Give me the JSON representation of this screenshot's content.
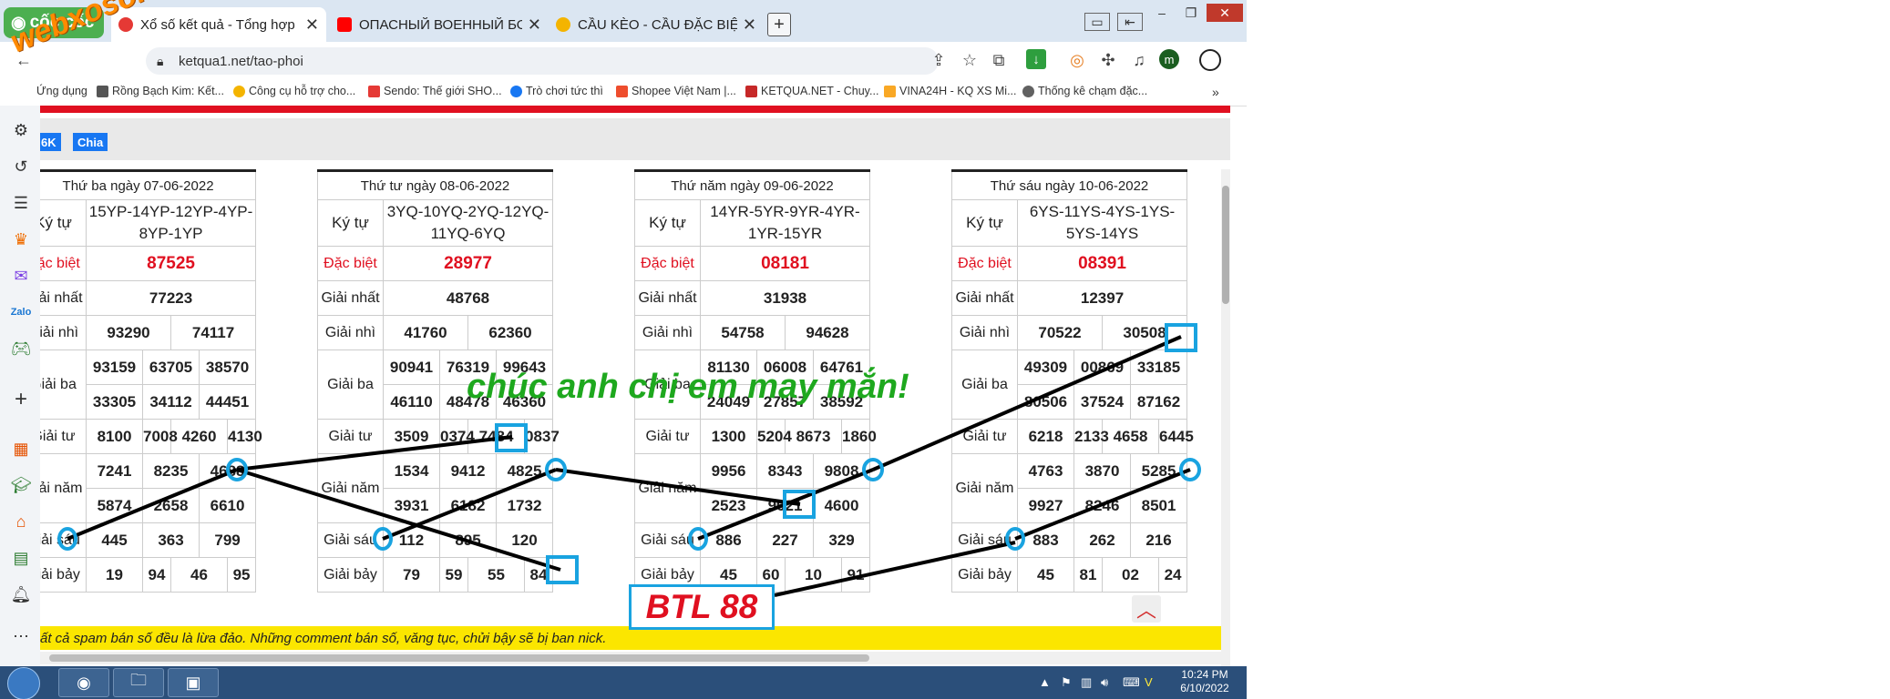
{
  "browser": {
    "brand": "cốc cốc",
    "tabs": [
      {
        "title": "Xổ số kết quả - Tổng hợp",
        "active": true,
        "fav_color": "#e53935"
      },
      {
        "title": "ОПАСНЫЙ ВОЕННЫЙ БОЕВ",
        "active": false,
        "fav_color": "#ff0000"
      },
      {
        "title": "CẦU KÈO - CẦU ĐẶC BIỆT NG",
        "active": false,
        "fav_color": "#f4b400"
      }
    ],
    "url": "ketqua1.net/tao-phoi",
    "profile_initial": "m"
  },
  "bookmarks": [
    {
      "label": "Ứng dụng",
      "color": "#4285f4"
    },
    {
      "label": "Rồng Bạch Kim: Kết...",
      "color": "#555555"
    },
    {
      "label": "Công cụ hỗ trợ cho...",
      "color": "#f4b400"
    },
    {
      "label": "Sendo: Thế giới SHO...",
      "color": "#e53935"
    },
    {
      "label": "Trò chơi tức thì",
      "color": "#1877f2"
    },
    {
      "label": "Shopee Việt Nam |...",
      "color": "#ee4d2d"
    },
    {
      "label": "KETQUA.NET - Chuy...",
      "color": "#c62828"
    },
    {
      "label": "VINA24H - KQ XS Mi...",
      "color": "#f9a825"
    },
    {
      "label": "Thống kê chạm đặc...",
      "color": "#616161"
    }
  ],
  "page": {
    "social_buttons": [
      "6K",
      "Chia"
    ],
    "footer_notice": "ất cả spam bán số đều là lừa đảo. Những comment bán số, văng tục, chửi bậy sẽ bị ban nick."
  },
  "tables": [
    {
      "header": "Thứ ba ngày 07-06-2022",
      "codes": "15YP-14YP-12YP-4YP-8YP-1YP",
      "special": "87525",
      "first": "77223",
      "second": [
        "93290",
        "74117"
      ],
      "third": [
        "93159",
        "63705",
        "38570",
        "33305",
        "34112",
        "44451"
      ],
      "fourth": [
        "8100",
        "7008",
        "4260",
        "4130"
      ],
      "fifth": [
        "7241",
        "8235",
        "4688",
        "5874",
        "2658",
        "6610"
      ],
      "sixth": [
        "445",
        "363",
        "799"
      ],
      "seventh": [
        "19",
        "94",
        "46",
        "95"
      ]
    },
    {
      "header": "Thứ tư ngày 08-06-2022",
      "codes": "3YQ-10YQ-2YQ-12YQ-11YQ-6YQ",
      "special": "28977",
      "first": "48768",
      "second": [
        "41760",
        "62360"
      ],
      "third": [
        "90941",
        "76319",
        "99643",
        "46110",
        "48478",
        "46360"
      ],
      "fourth": [
        "3509",
        "0374",
        "7484",
        "0837"
      ],
      "fifth": [
        "1534",
        "9412",
        "4825",
        "3931",
        "6182",
        "1732"
      ],
      "sixth": [
        "112",
        "895",
        "120"
      ],
      "seventh": [
        "79",
        "59",
        "55",
        "84"
      ]
    },
    {
      "header": "Thứ năm ngày 09-06-2022",
      "codes": "14YR-5YR-9YR-4YR-1YR-15YR",
      "special": "08181",
      "first": "31938",
      "second": [
        "54758",
        "94628"
      ],
      "third": [
        "81130",
        "06008",
        "64761",
        "24049",
        "27857",
        "38592"
      ],
      "fourth": [
        "1300",
        "5204",
        "8673",
        "1860"
      ],
      "fifth": [
        "9956",
        "8343",
        "9808",
        "2523",
        "9621",
        "4600"
      ],
      "sixth": [
        "886",
        "227",
        "329"
      ],
      "seventh": [
        "45",
        "60",
        "10",
        "91"
      ]
    },
    {
      "header": "Thứ sáu ngày 10-06-2022",
      "codes": "6YS-11YS-4YS-1YS-5YS-14YS",
      "special": "08391",
      "first": "12397",
      "second": [
        "70522",
        "30508"
      ],
      "third": [
        "49309",
        "00869",
        "33185",
        "80506",
        "37524",
        "87162"
      ],
      "fourth": [
        "6218",
        "2133",
        "4658",
        "6445"
      ],
      "fifth": [
        "4763",
        "3870",
        "5285",
        "9927",
        "8246",
        "8501"
      ],
      "sixth": [
        "883",
        "262",
        "216"
      ],
      "seventh": [
        "45",
        "81",
        "02",
        "24"
      ]
    }
  ],
  "labels": {
    "ky_tu": "Ký tự",
    "special": "Đặc biệt",
    "first": "Giải nhất",
    "second": "Giải nhì",
    "third": "Giải ba",
    "fourth": "Giải tư",
    "fifth": "Giải năm",
    "sixth": "Giải sáu",
    "seventh": "Giải bảy"
  },
  "overlay": {
    "watermark": "webxoso.net",
    "wish": "chúc anh chị em may mắn!",
    "result_box": "BTL 88"
  },
  "taskbar": {
    "time": "10:24 PM",
    "date": "6/10/2022"
  }
}
